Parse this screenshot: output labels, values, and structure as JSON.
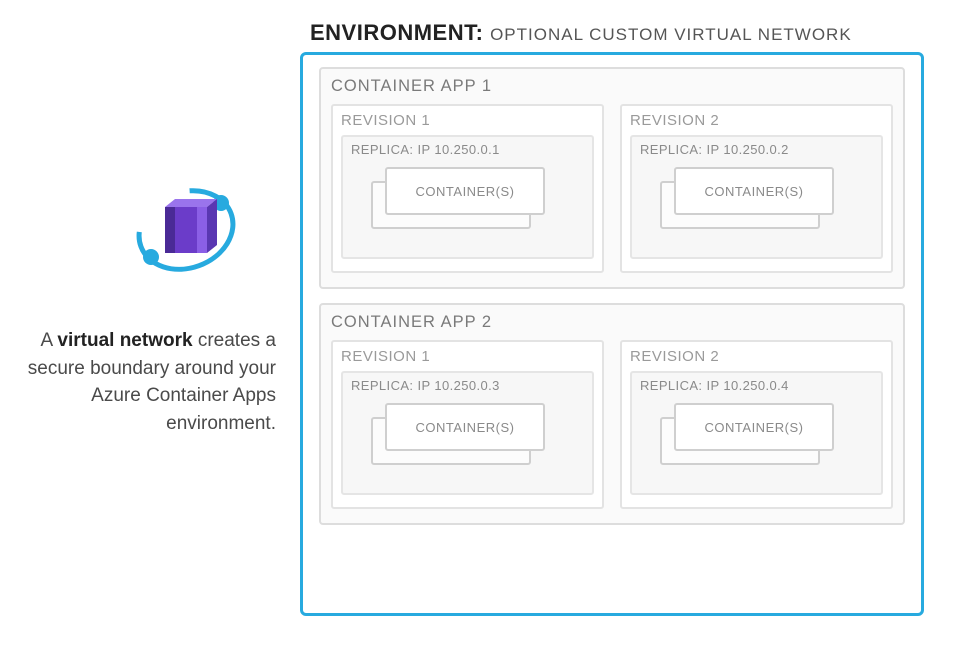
{
  "description": {
    "pre": "A ",
    "bold": "virtual network",
    "post": " creates a secure boundary around your Azure Container Apps environment."
  },
  "environment": {
    "label": "ENVIRONMENT:",
    "sublabel": "OPTIONAL CUSTOM VIRTUAL NETWORK"
  },
  "apps": [
    {
      "title": "CONTAINER APP 1",
      "revisions": [
        {
          "title": "REVISION 1",
          "replica": "REPLICA: IP 10.250.0.1",
          "card": "CONTAINER(S)"
        },
        {
          "title": "REVISION 2",
          "replica": "REPLICA: IP 10.250.0.2",
          "card": "CONTAINER(S)"
        }
      ]
    },
    {
      "title": "CONTAINER APP 2",
      "revisions": [
        {
          "title": "REVISION 1",
          "replica": "REPLICA: IP 10.250.0.3",
          "card": "CONTAINER(S)"
        },
        {
          "title": "REVISION 2",
          "replica": "REPLICA: IP 10.250.0.4",
          "card": "CONTAINER(S)"
        }
      ]
    }
  ]
}
